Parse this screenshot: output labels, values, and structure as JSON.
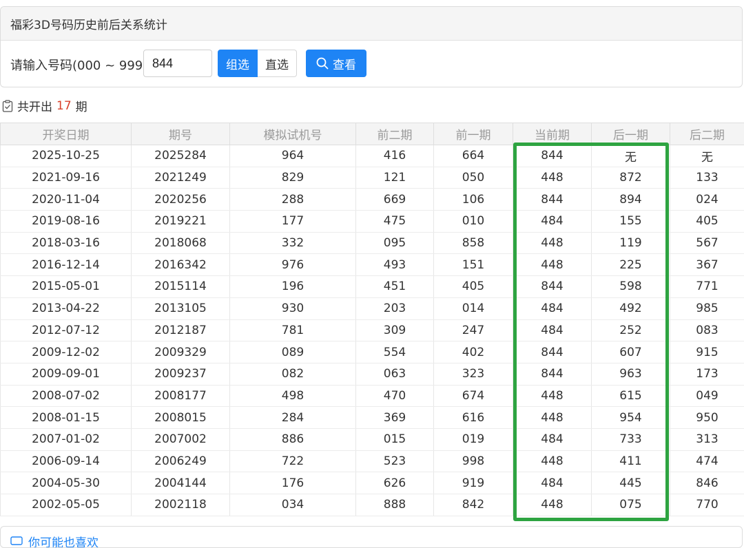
{
  "panel": {
    "title": "福彩3D号码历史前后关系统计"
  },
  "form": {
    "label": "请输入号码(000 ~ 999)：",
    "value": "844",
    "mode_group": "组选",
    "mode_direct": "直选",
    "search_label": "查看"
  },
  "summary": {
    "prefix": "共开出",
    "count": "17",
    "suffix": "期"
  },
  "table": {
    "headers": [
      "开奖日期",
      "期号",
      "模拟试机号",
      "前二期",
      "前一期",
      "当前期",
      "后一期",
      "后二期"
    ],
    "rows": [
      [
        "2025-10-25",
        "2025284",
        "964",
        "416",
        "664",
        "844",
        "无",
        "无"
      ],
      [
        "2021-09-16",
        "2021249",
        "829",
        "121",
        "050",
        "448",
        "872",
        "133"
      ],
      [
        "2020-11-04",
        "2020256",
        "288",
        "669",
        "106",
        "844",
        "894",
        "024"
      ],
      [
        "2019-08-16",
        "2019221",
        "177",
        "475",
        "010",
        "484",
        "155",
        "405"
      ],
      [
        "2018-03-16",
        "2018068",
        "332",
        "095",
        "858",
        "448",
        "119",
        "567"
      ],
      [
        "2016-12-14",
        "2016342",
        "976",
        "493",
        "151",
        "448",
        "225",
        "367"
      ],
      [
        "2015-05-01",
        "2015114",
        "196",
        "451",
        "405",
        "844",
        "598",
        "771"
      ],
      [
        "2013-04-22",
        "2013105",
        "930",
        "203",
        "014",
        "484",
        "492",
        "985"
      ],
      [
        "2012-07-12",
        "2012187",
        "781",
        "309",
        "247",
        "484",
        "252",
        "083"
      ],
      [
        "2009-12-02",
        "2009329",
        "089",
        "554",
        "402",
        "844",
        "607",
        "915"
      ],
      [
        "2009-09-01",
        "2009237",
        "082",
        "063",
        "323",
        "844",
        "963",
        "173"
      ],
      [
        "2008-07-02",
        "2008177",
        "498",
        "470",
        "674",
        "448",
        "615",
        "049"
      ],
      [
        "2008-01-15",
        "2008015",
        "284",
        "369",
        "616",
        "448",
        "954",
        "950"
      ],
      [
        "2007-01-02",
        "2007002",
        "886",
        "015",
        "019",
        "484",
        "733",
        "313"
      ],
      [
        "2006-09-14",
        "2006249",
        "722",
        "523",
        "998",
        "448",
        "411",
        "474"
      ],
      [
        "2004-05-30",
        "2004144",
        "176",
        "626",
        "919",
        "484",
        "445",
        "846"
      ],
      [
        "2002-05-05",
        "2002118",
        "034",
        "888",
        "842",
        "448",
        "075",
        "770"
      ]
    ]
  },
  "footer": {
    "text": "你可能也喜欢"
  },
  "colors": {
    "accent": "#1e84f5",
    "highlight": "#2ea441",
    "count": "#d9412b"
  }
}
